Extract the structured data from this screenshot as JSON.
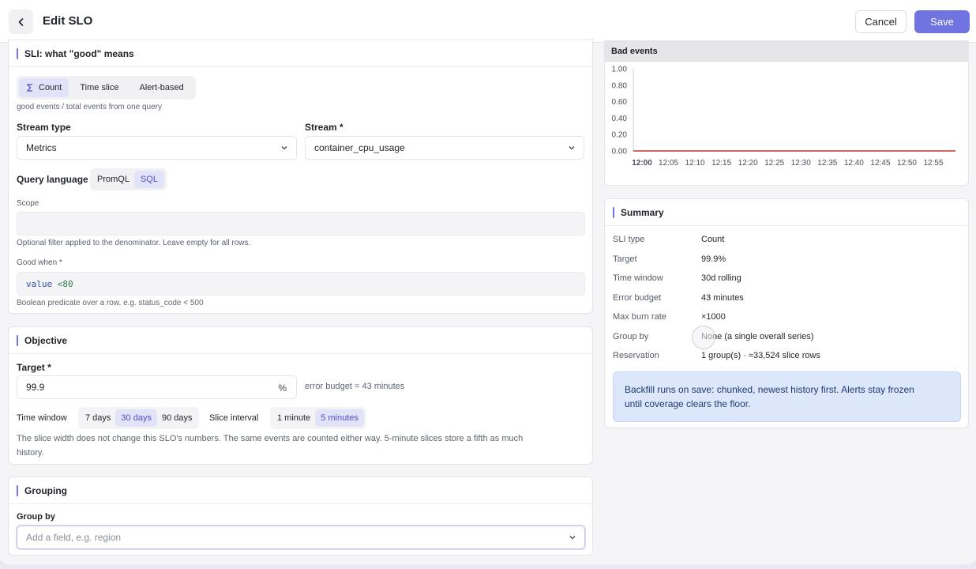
{
  "header": {
    "title": "Edit SLO",
    "cancel_label": "Cancel",
    "save_label": "Save"
  },
  "sli": {
    "section_title": "SLI: what \"good\" means",
    "mode_tabs": [
      {
        "label": "Count",
        "active": true
      },
      {
        "label": "Time slice",
        "active": false
      },
      {
        "label": "Alert-based",
        "active": false
      }
    ],
    "mode_hint": "good events / total events from one query",
    "stream_type_label": "Stream type",
    "stream_type_value": "Metrics",
    "stream_label": "Stream *",
    "stream_value": "container_cpu_usage",
    "query_language_label": "Query language",
    "query_languages": [
      {
        "label": "PromQL",
        "active": false
      },
      {
        "label": "SQL",
        "active": true
      }
    ],
    "scope_label": "Scope",
    "scope_value": "",
    "scope_hint": "Optional filter applied to the denominator. Leave empty for all rows.",
    "good_when_label": "Good when *",
    "good_when_keyword": "value",
    "good_when_rest": "<80",
    "good_when_hint": "Boolean predicate over a row, e.g. status_code < 500"
  },
  "objective": {
    "section_title": "Objective",
    "target_label": "Target *",
    "target_value": "99.9",
    "target_unit": "%",
    "error_budget_hint": "error budget = 43 minutes",
    "time_window_label": "Time window",
    "time_windows": [
      {
        "label": "7 days",
        "active": false
      },
      {
        "label": "30 days",
        "active": true
      },
      {
        "label": "90 days",
        "active": false
      }
    ],
    "slice_interval_label": "Slice interval",
    "slice_intervals": [
      {
        "label": "1 minute",
        "active": false
      },
      {
        "label": "5 minutes",
        "active": true
      }
    ],
    "slice_hint_line1": "The slice width does not change this SLO's numbers. The same events are counted either way. 5-minute slices store a fifth as much",
    "slice_hint_line2": "history."
  },
  "grouping": {
    "section_title": "Grouping",
    "group_by_label": "Group by",
    "group_by_placeholder": "Add a field, e.g. region"
  },
  "chart_data": {
    "type": "line",
    "title": "Bad events",
    "x": [
      "12:00",
      "12:05",
      "12:10",
      "12:15",
      "12:20",
      "12:25",
      "12:30",
      "12:35",
      "12:40",
      "12:45",
      "12:50",
      "12:55"
    ],
    "y_ticks": [
      "1.00",
      "0.80",
      "0.60",
      "0.40",
      "0.20",
      "0.00"
    ],
    "series": [
      {
        "values": [
          0,
          0,
          0,
          0,
          0,
          0,
          0,
          0,
          0,
          0,
          0,
          0
        ],
        "color": "#c0392b"
      }
    ],
    "ylim": [
      0,
      1
    ],
    "grid": false
  },
  "summary": {
    "section_title": "Summary",
    "rows": [
      {
        "key": "SLI type",
        "value": "Count"
      },
      {
        "key": "Target",
        "value": "99.9%"
      },
      {
        "key": "Time window",
        "value": "30d rolling"
      },
      {
        "key": "Error budget",
        "value": "43 minutes"
      },
      {
        "key": "Max burn rate",
        "value": "×1000"
      },
      {
        "key": "Group by",
        "value": "None (a single overall series)"
      },
      {
        "key": "Reservation",
        "value": "1 group(s) · ≈33,524 slice rows"
      }
    ],
    "info_line1": "Backfill runs on save: chunked, newest history first. Alerts stay frozen",
    "info_line2": "until coverage clears the floor."
  },
  "colors": {
    "accent": "#6f74e0",
    "line": "#c0392b"
  },
  "icons": {
    "back": "chevron-left-icon",
    "dropdown": "chevron-down-icon",
    "count": "sigma-icon"
  }
}
